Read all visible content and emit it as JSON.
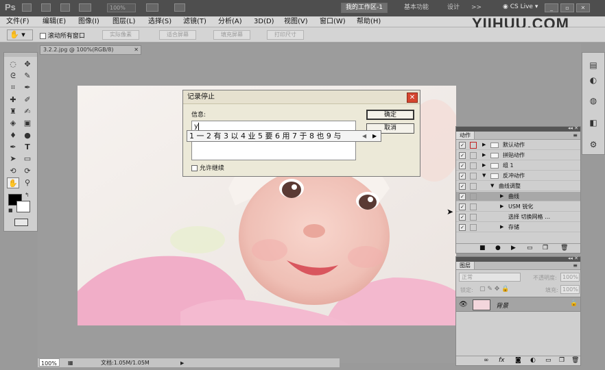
{
  "app": {
    "logo": "Ps",
    "zoom": "100%"
  },
  "workspace": {
    "active": "我的工作区-1",
    "basic": "基本功能",
    "design": "设计",
    "more": ">>",
    "cslive": "CS Live"
  },
  "menu": [
    "文件(F)",
    "编辑(E)",
    "图像(I)",
    "图层(L)",
    "选择(S)",
    "滤镜(T)",
    "分析(A)",
    "3D(D)",
    "视图(V)",
    "窗口(W)",
    "帮助(H)"
  ],
  "watermark": "YIIHUU.COM",
  "options": {
    "scroll_all": "滚动所有窗口",
    "actual": "实际像素",
    "fit": "适合屏幕",
    "fill": "填充屏幕",
    "print": "打印尺寸"
  },
  "document": {
    "tab": "3.2.2.jpg @ 100%(RGB/8)",
    "zoom": "100%",
    "doc_size": "文档:1.05M/1.05M"
  },
  "dialog": {
    "title": "记录停止",
    "message_label": "信息:",
    "input_value": "y",
    "ok": "确定",
    "cancel": "取消",
    "allow_continue": "允许继续"
  },
  "ime": {
    "candidates": "1 一  2 有  3 以  4 业  5 要  6 用  7 于  8 也  9 与"
  },
  "actions_panel": {
    "title": "动作",
    "rows": [
      {
        "label": "默认动作",
        "type": "set",
        "red": true
      },
      {
        "label": "拼贴动作",
        "type": "set",
        "red": false
      },
      {
        "label": "组 1",
        "type": "set",
        "red": false
      },
      {
        "label": "反冲动作",
        "type": "set-open",
        "red": false
      },
      {
        "label": "曲线调整",
        "type": "action-open",
        "red": false
      },
      {
        "label": "曲线",
        "type": "step",
        "red": false
      },
      {
        "label": "USM 锐化",
        "type": "step",
        "red": false
      },
      {
        "label": "选择 切换网格 …",
        "type": "step-plain",
        "red": false
      },
      {
        "label": "存储",
        "type": "step",
        "red": false
      }
    ]
  },
  "layers_panel": {
    "title": "图层",
    "blend": "正常",
    "opacity_label": "不透明度:",
    "opacity": "100%",
    "lock_label": "锁定:",
    "fill_label": "填充:",
    "fill": "100%",
    "layer_name": "背景"
  }
}
